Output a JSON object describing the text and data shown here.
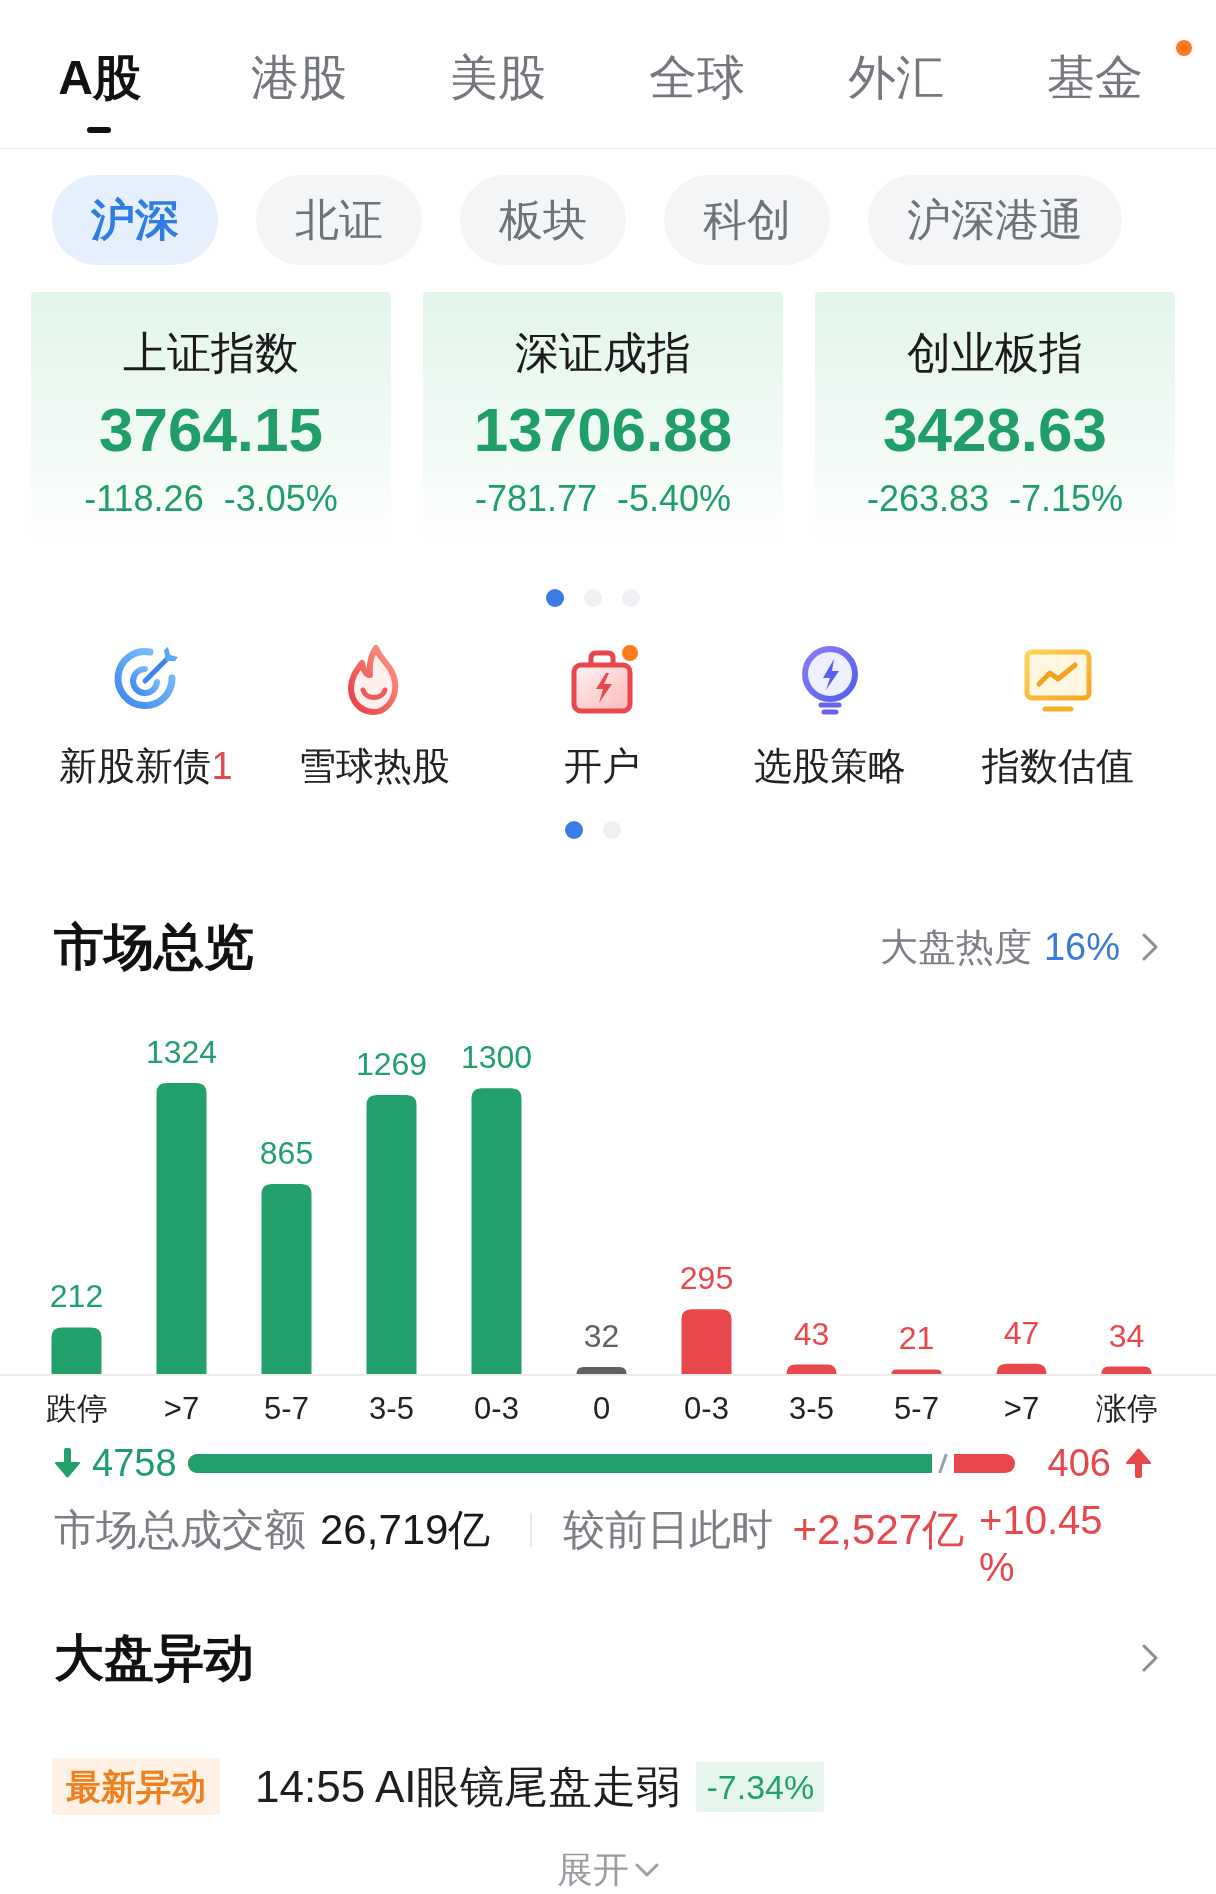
{
  "market_tabs": [
    {
      "label": "A股",
      "selected": true,
      "dot": false
    },
    {
      "label": "港股",
      "selected": false,
      "dot": false
    },
    {
      "label": "美股",
      "selected": false,
      "dot": false
    },
    {
      "label": "全球",
      "selected": false,
      "dot": false
    },
    {
      "label": "外汇",
      "selected": false,
      "dot": false
    },
    {
      "label": "基金",
      "selected": false,
      "dot": true
    }
  ],
  "sub_tabs": [
    {
      "label": "沪深",
      "selected": true
    },
    {
      "label": "北证",
      "selected": false
    },
    {
      "label": "板块",
      "selected": false
    },
    {
      "label": "科创",
      "selected": false
    },
    {
      "label": "沪深港通",
      "selected": false
    }
  ],
  "index_cards": [
    {
      "name": "上证指数",
      "value": "3764.15",
      "change": "-118.26",
      "change_percent": "-3.05%"
    },
    {
      "name": "深证成指",
      "value": "13706.88",
      "change": "-781.77",
      "change_percent": "-5.40%"
    },
    {
      "name": "创业板指",
      "value": "3428.63",
      "change": "-263.83",
      "change_percent": "-7.15%"
    }
  ],
  "index_pager": [
    {
      "selected": true
    },
    {
      "selected": false
    },
    {
      "selected": false
    }
  ],
  "shortcuts": [
    {
      "label": "新股新债",
      "count": "1",
      "dot": false
    },
    {
      "label": "雪球热股",
      "dot": false
    },
    {
      "label": "开户",
      "dot": true
    },
    {
      "label": "选股策略",
      "dot": false
    },
    {
      "label": "指数估值",
      "dot": false
    }
  ],
  "shortcut_pager": [
    {
      "selected": true
    },
    {
      "selected": false
    }
  ],
  "market_overview": {
    "title": "市场总览",
    "heat_label": "大盘热度",
    "heat_value": "16%",
    "chart_data": {
      "type": "bar",
      "categories": [
        "跌停",
        ">7",
        "5-7",
        "3-5",
        "0-3",
        "0",
        "0-3",
        "3-5",
        "5-7",
        ">7",
        "涨停"
      ],
      "series": [
        {
          "color": "#22a06b",
          "values": [
            212,
            1324,
            865,
            1269,
            1300,
            null,
            null,
            null,
            null,
            null,
            null
          ]
        },
        {
          "color": "#5f6165",
          "values": [
            null,
            null,
            null,
            null,
            null,
            32,
            null,
            null,
            null,
            null,
            null
          ]
        },
        {
          "color": "#e8474c",
          "values": [
            null,
            null,
            null,
            null,
            null,
            null,
            295,
            43,
            21,
            47,
            34
          ]
        }
      ],
      "stacked": true,
      "data_labels": true
    },
    "down_count": "4758",
    "up_count": "406",
    "breadth_bar": {
      "level": 0.91
    },
    "turnover_label": "市场总成交额",
    "turnover_value": "26,719亿",
    "compare_label": "较前日此时",
    "compare_change": "+2,527亿",
    "compare_percent": "+10.45%"
  },
  "market_moves": {
    "title": "大盘异动",
    "tag": "最新异动",
    "headline": "14:55 AI眼镜尾盘走弱",
    "change": "-7.34%",
    "expand_label": "展开"
  }
}
